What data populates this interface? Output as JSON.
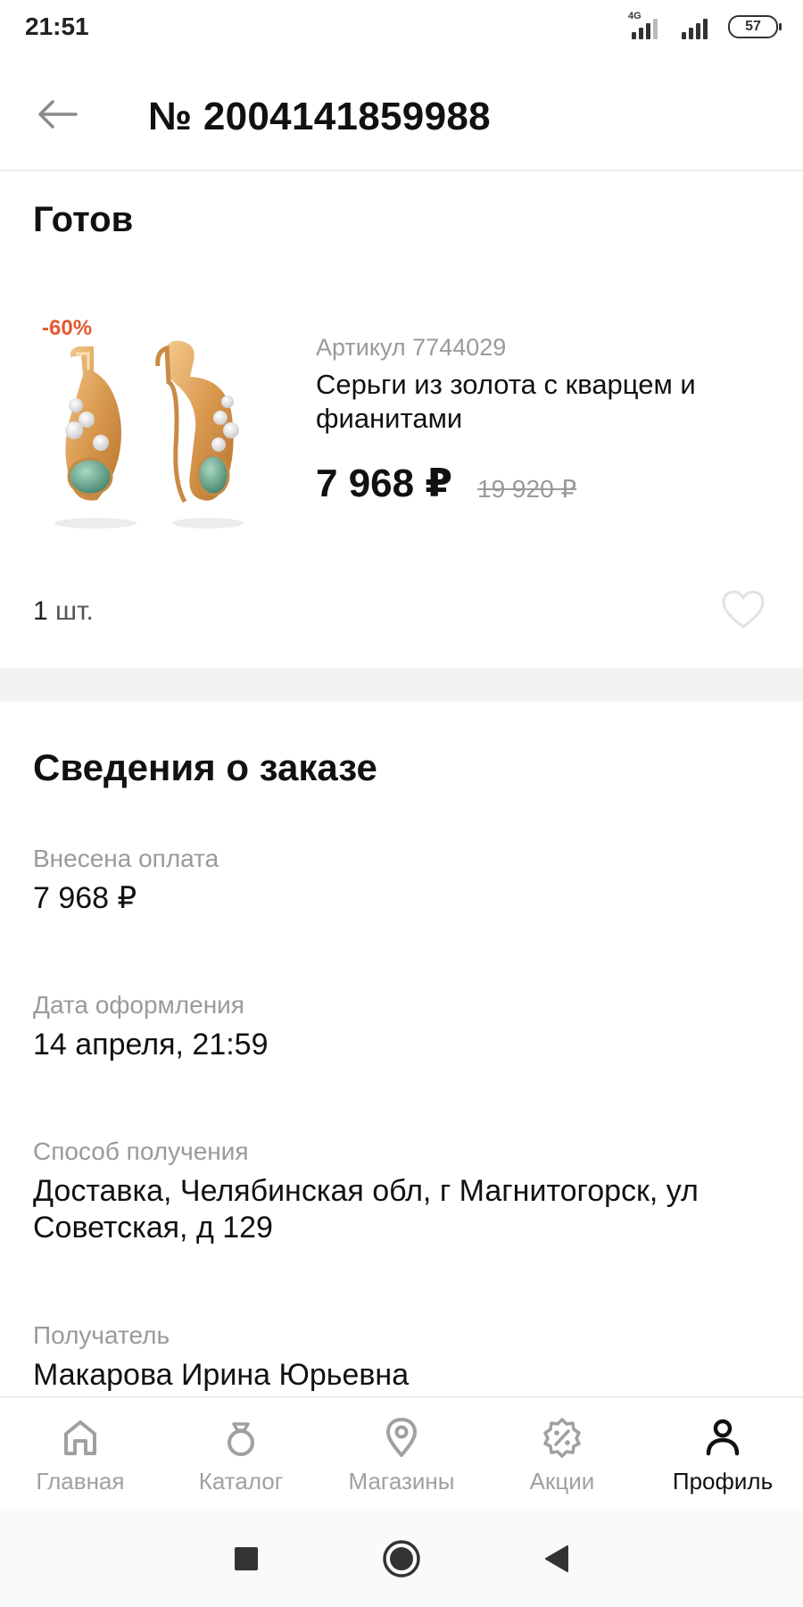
{
  "status_bar": {
    "time": "21:51",
    "network": "4G",
    "battery": "57",
    "icons": [
      "signal-4g-icon",
      "signal-icon",
      "battery-icon"
    ]
  },
  "header": {
    "title": "№ 2004141859988",
    "back_icon": "arrow-left-icon"
  },
  "order_status": {
    "title": "Готов"
  },
  "product": {
    "discount": "-60%",
    "article": "Артикул 7744029",
    "name": "Серьги из золота с кварцем и фианитами",
    "price": "7 968 ₽",
    "old_price": "19 920 ₽",
    "quantity": "1",
    "unit": "шт.",
    "favorite_icon": "heart-outline-icon",
    "image": "earrings-gold-quartz-image"
  },
  "order_info": {
    "title": "Сведения о заказе",
    "fields": [
      {
        "label": "Внесена оплата",
        "value": "7 968 ₽"
      },
      {
        "label": "Дата оформления",
        "value": "14 апреля, 21:59"
      },
      {
        "label": "Способ получения",
        "value": "Доставка, Челябинская обл, г Магнитогорск, ул Советская, д 129"
      },
      {
        "label": "Получатель",
        "value": "Макарова Ирина Юрьевна"
      }
    ]
  },
  "bottom_nav": {
    "items": [
      {
        "label": "Главная",
        "icon": "home-icon",
        "active": false
      },
      {
        "label": "Каталог",
        "icon": "ring-icon",
        "active": false
      },
      {
        "label": "Магазины",
        "icon": "map-pin-icon",
        "active": false
      },
      {
        "label": "Акции",
        "icon": "percent-badge-icon",
        "active": false
      },
      {
        "label": "Профиль",
        "icon": "user-icon",
        "active": true
      }
    ]
  },
  "colors": {
    "accent_discount": "#e4572e",
    "text_primary": "#111111",
    "text_secondary": "#9a9a9a",
    "gold": "#d9a05b",
    "gem_green": "#5fa08a"
  }
}
